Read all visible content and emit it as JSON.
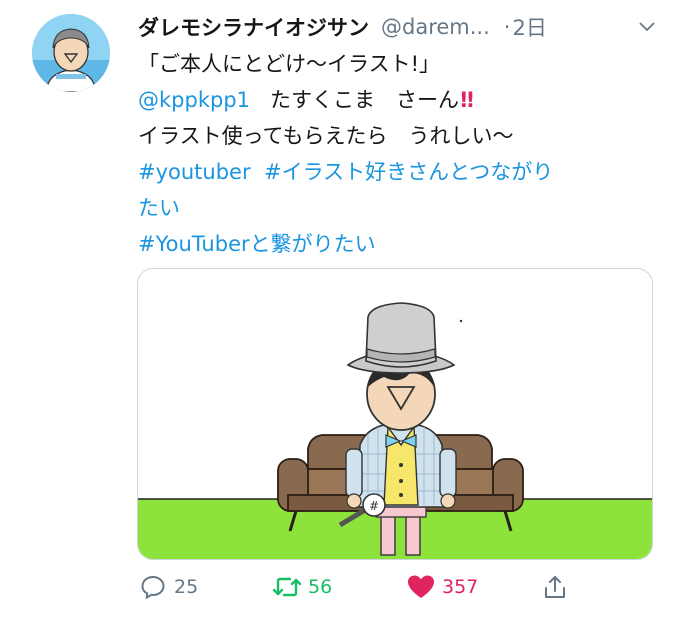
{
  "tweet": {
    "display_name": "ダレモシラナイオジサン",
    "handle": "@darem...",
    "separator": "·",
    "time": "2日",
    "text": {
      "line1": "「ご本人にとどけ〜イラスト!」",
      "mention": "@kppkpp1",
      "line2_rest": "たすくこま　さーん",
      "line2_emoji": "!!",
      "line3": "イラスト使ってもらえたら　うれしい〜",
      "hashtag1": "#youtuber",
      "hashtag2_part1": "#イラスト好きさんとつながり",
      "hashtag2_part2": "たい",
      "hashtag3": "#YouTuberと繋がりたい"
    }
  },
  "actions": {
    "reply_count": "25",
    "retweet_count": "56",
    "like_count": "357"
  },
  "icons": [
    "reply-icon",
    "retweet-icon",
    "like-icon",
    "share-icon",
    "chevron-down-icon"
  ],
  "colors": {
    "link": "#1b95e0",
    "retweet": "#17bf63",
    "like": "#e0245e",
    "secondary_text": "#657786"
  }
}
